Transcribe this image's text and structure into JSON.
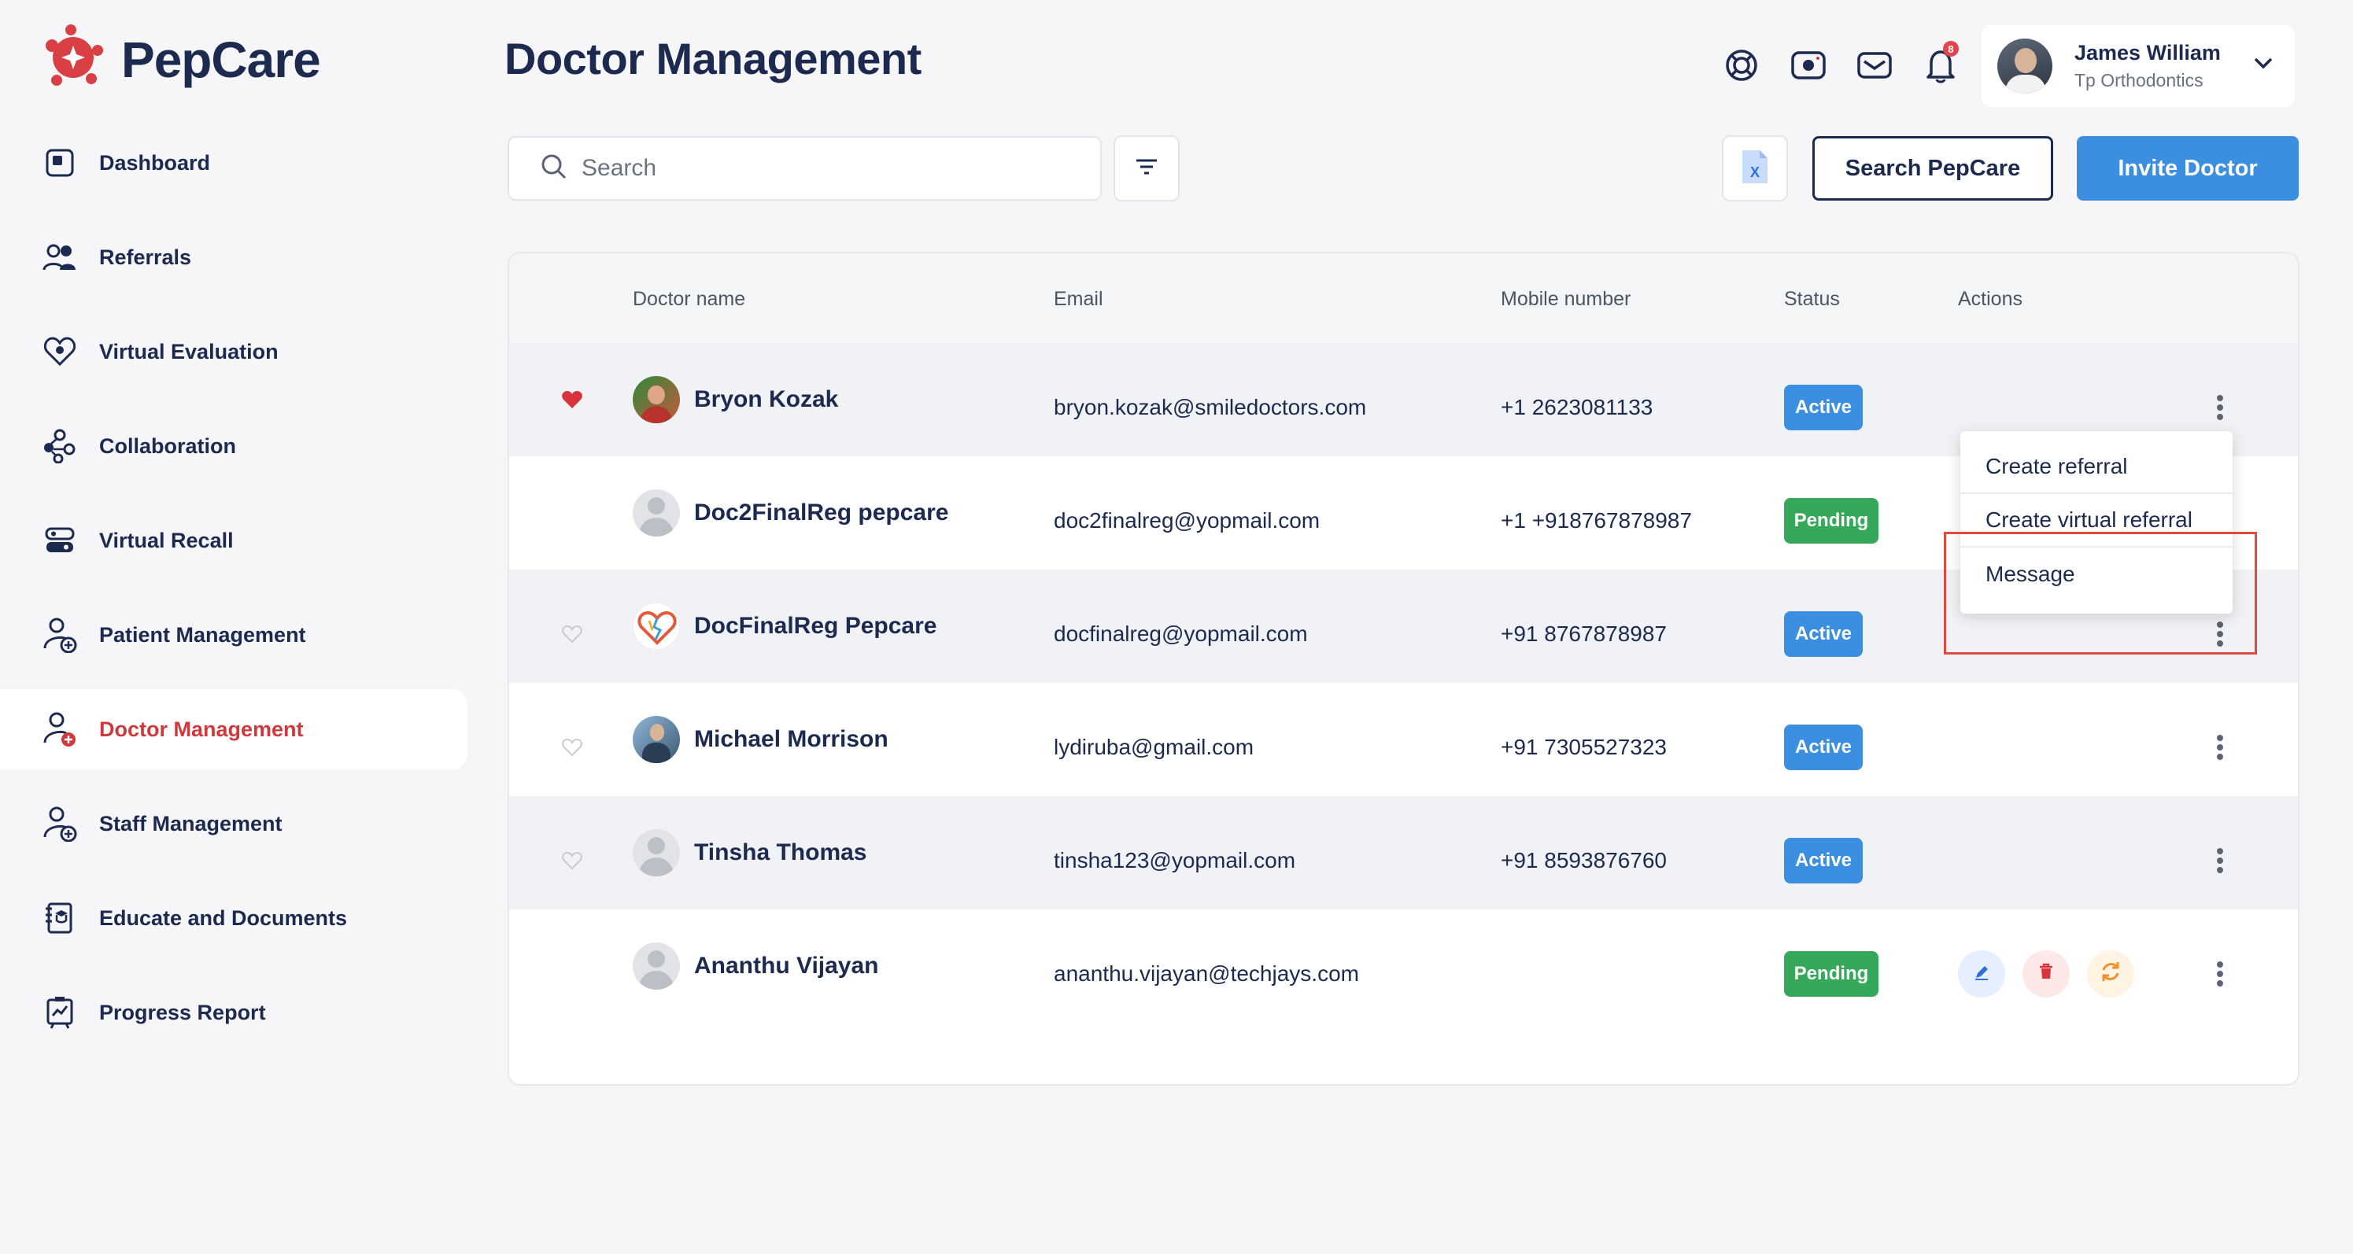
{
  "app": {
    "name": "PepCare"
  },
  "sidebar": {
    "items": [
      {
        "label": "Dashboard",
        "icon": "dashboard-icon"
      },
      {
        "label": "Referrals",
        "icon": "referrals-icon"
      },
      {
        "label": "Virtual Evaluation",
        "icon": "heart-badge-icon"
      },
      {
        "label": "Collaboration",
        "icon": "collaboration-icon"
      },
      {
        "label": "Virtual Recall",
        "icon": "recall-icon"
      },
      {
        "label": "Patient Management",
        "icon": "patient-icon"
      },
      {
        "label": "Doctor Management",
        "icon": "doctor-icon",
        "active": true
      },
      {
        "label": "Staff Management",
        "icon": "staff-icon"
      },
      {
        "label": "Educate and Documents",
        "icon": "documents-icon"
      },
      {
        "label": "Progress Report",
        "icon": "report-icon"
      }
    ]
  },
  "header": {
    "title": "Doctor Management",
    "notification_count": "8",
    "user": {
      "name": "James William",
      "org": "Tp Orthodontics"
    }
  },
  "toolbar": {
    "search_placeholder": "Search",
    "search_pepcare_label": "Search PepCare",
    "invite_doctor_label": "Invite Doctor"
  },
  "table": {
    "columns": [
      "Doctor name",
      "Email",
      "Mobile number",
      "Status",
      "Actions"
    ],
    "rows": [
      {
        "name": "Bryon Kozak",
        "email": "bryon.kozak@smiledoctors.com",
        "mobile": "+1 2623081133",
        "status": "Active",
        "favorite": true
      },
      {
        "name": "Doc2FinalReg pepcare",
        "email": "doc2finalreg@yopmail.com",
        "mobile": "+1 +918767878987",
        "status": "Pending",
        "favorite": null
      },
      {
        "name": "DocFinalReg Pepcare",
        "email": "docfinalreg@yopmail.com",
        "mobile": "+91 8767878987",
        "status": "Active",
        "favorite": false
      },
      {
        "name": "Michael Morrison",
        "email": "lydiruba@gmail.com",
        "mobile": "+91 7305527323",
        "status": "Active",
        "favorite": false
      },
      {
        "name": "Tinsha Thomas",
        "email": "tinsha123@yopmail.com",
        "mobile": "+91 8593876760",
        "status": "Active",
        "favorite": false
      },
      {
        "name": "Ananthu Vijayan",
        "email": "ananthu.vijayan@techjays.com",
        "mobile": "",
        "status": "Pending",
        "favorite": null
      }
    ]
  },
  "dropdown": {
    "items": [
      "Create referral",
      "Create virtual referral",
      "Message"
    ]
  },
  "colors": {
    "brand_red": "#d0393c",
    "primary_blue": "#3b8ee0",
    "pending_green": "#35a85a",
    "navy": "#1c2a4f"
  }
}
